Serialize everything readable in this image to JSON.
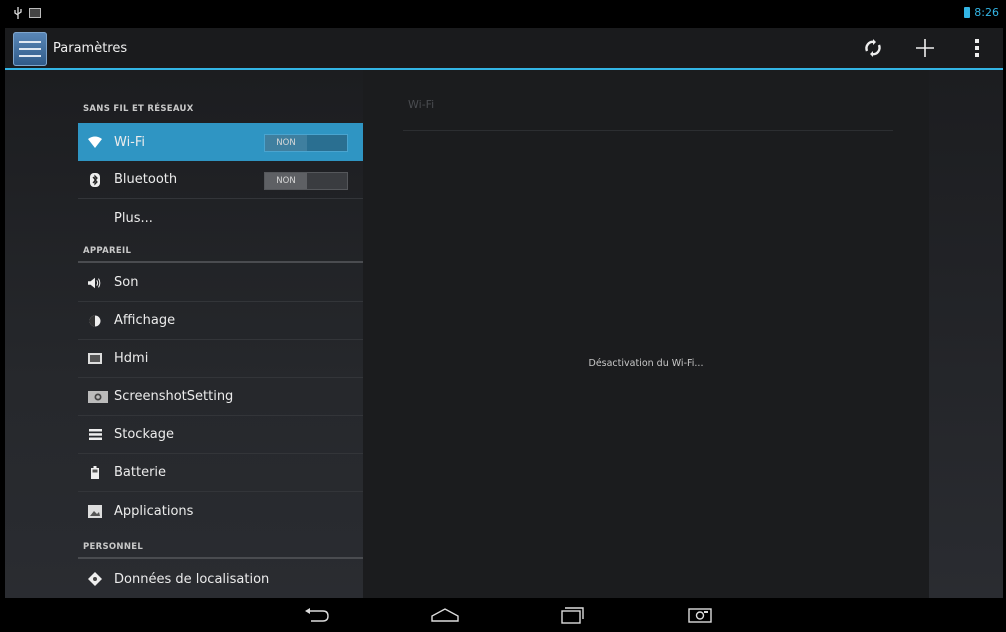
{
  "status_bar": {
    "time": "8:26",
    "icons": [
      "usb-icon",
      "image-notification-icon",
      "battery-icon"
    ]
  },
  "action_bar": {
    "title": "Paramètres",
    "actions": [
      "sync-icon",
      "add-icon",
      "overflow-menu-icon"
    ]
  },
  "colors": {
    "accent": "#33b5e5",
    "selected_row": "#2f95c3",
    "background": "#121314"
  },
  "settings": {
    "sections": [
      {
        "header": "SANS FIL ET RÉSEAUX",
        "items": [
          {
            "label": "Wi-Fi",
            "icon": "wifi-icon",
            "toggle": "NON",
            "selected": true
          },
          {
            "label": "Bluetooth",
            "icon": "bluetooth-icon",
            "toggle": "NON"
          },
          {
            "label": "Plus...",
            "icon": ""
          }
        ]
      },
      {
        "header": "APPAREIL",
        "items": [
          {
            "label": "Son",
            "icon": "speaker-icon"
          },
          {
            "label": "Affichage",
            "icon": "brightness-icon"
          },
          {
            "label": "Hdmi",
            "icon": "hdmi-icon"
          },
          {
            "label": "ScreenshotSetting",
            "icon": "camera-icon"
          },
          {
            "label": "Stockage",
            "icon": "storage-icon"
          },
          {
            "label": "Batterie",
            "icon": "battery-icon"
          },
          {
            "label": "Applications",
            "icon": "applications-icon"
          }
        ]
      },
      {
        "header": "PERSONNEL",
        "items": [
          {
            "label": "Données de localisation",
            "icon": "location-icon"
          }
        ]
      }
    ]
  },
  "detail": {
    "title": "Wi-Fi",
    "message": "Désactivation du Wi-Fi..."
  },
  "nav_bar": {
    "buttons": [
      "back-icon",
      "home-icon",
      "recent-apps-icon",
      "screenshot-icon"
    ]
  }
}
